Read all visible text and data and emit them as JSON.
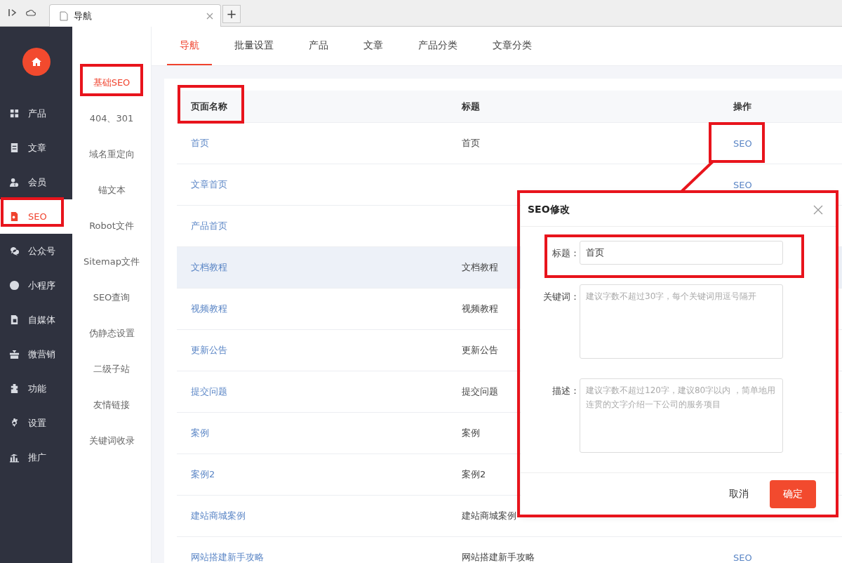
{
  "browser": {
    "tabs": [
      {
        "label": "导航",
        "selected": true
      }
    ],
    "new_tab": "+"
  },
  "sidebar": {
    "items": [
      {
        "label": "产品",
        "selected": false
      },
      {
        "label": "文章",
        "selected": false
      },
      {
        "label": "会员",
        "selected": false
      },
      {
        "label": "SEO",
        "selected": true
      },
      {
        "label": "公众号",
        "selected": false
      },
      {
        "label": "小程序",
        "selected": false
      },
      {
        "label": "自媒体",
        "selected": false
      },
      {
        "label": "微营销",
        "selected": false
      },
      {
        "label": "功能",
        "selected": false
      },
      {
        "label": "设置",
        "selected": false
      },
      {
        "label": "推广",
        "selected": false
      }
    ]
  },
  "submenu": {
    "items": [
      {
        "label": "基础SEO",
        "selected": true
      },
      {
        "label": "404、301",
        "selected": false
      },
      {
        "label": "域名重定向",
        "selected": false
      },
      {
        "label": "锚文本",
        "selected": false
      },
      {
        "label": "Robot文件",
        "selected": false
      },
      {
        "label": "Sitemap文件",
        "selected": false
      },
      {
        "label": "SEO查询",
        "selected": false
      },
      {
        "label": "伪静态设置",
        "selected": false
      },
      {
        "label": "二级子站",
        "selected": false
      },
      {
        "label": "友情链接",
        "selected": false
      },
      {
        "label": "关键词收录",
        "selected": false
      }
    ]
  },
  "tabs": [
    {
      "label": "导航",
      "selected": true
    },
    {
      "label": "批量设置",
      "selected": false
    },
    {
      "label": "产品",
      "selected": false
    },
    {
      "label": "文章",
      "selected": false
    },
    {
      "label": "产品分类",
      "selected": false
    },
    {
      "label": "文章分类",
      "selected": false
    }
  ],
  "table": {
    "columns": [
      "页面名称",
      "标题",
      "操作"
    ],
    "rows": [
      {
        "name": "首页",
        "title": "首页",
        "action": "SEO",
        "highlighted": false
      },
      {
        "name": "文章首页",
        "action": "SEO",
        "highlighted": false
      },
      {
        "name": "产品首页",
        "highlighted": false
      },
      {
        "name": "文档教程",
        "title": "文档教程",
        "highlighted": true
      },
      {
        "name": "视频教程",
        "title": "视频教程",
        "highlighted": false
      },
      {
        "name": "更新公告",
        "title": "更新公告",
        "highlighted": false
      },
      {
        "name": "提交问题",
        "title": "提交问题",
        "highlighted": false
      },
      {
        "name": "案例",
        "title": "案例",
        "highlighted": false
      },
      {
        "name": "案例2",
        "title": "案例2",
        "highlighted": false
      },
      {
        "name": "建站商城案例",
        "title": "建站商城案例",
        "highlighted": false
      },
      {
        "name": "网站搭建新手攻略",
        "title": "网站搭建新手攻略",
        "action": "SEO",
        "highlighted": false
      }
    ]
  },
  "dialog": {
    "title": "SEO修改",
    "fields": [
      {
        "kind": "input",
        "label": "标题：",
        "value": "首页"
      },
      {
        "kind": "textarea",
        "label": "关键词：",
        "placeholder": "建议字数不超过30字，每个关键词用逗号隔开"
      },
      {
        "kind": "textarea",
        "label": "描述：",
        "placeholder": "建议字数不超过120字，建议80字以内 ，简单地用连贯的文字介绍一下公司的服务项目"
      }
    ],
    "buttons": [
      {
        "kind": "secondary",
        "label": "取消"
      },
      {
        "kind": "primary",
        "label": "确定"
      }
    ]
  }
}
